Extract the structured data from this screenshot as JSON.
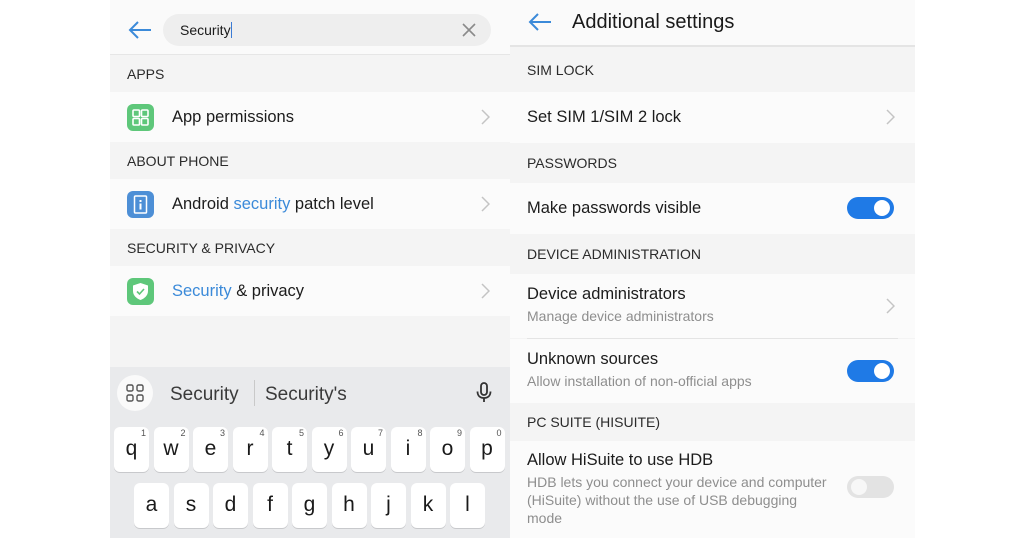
{
  "left_screen": {
    "search": {
      "value": "Security",
      "clear_icon": "close-icon",
      "back_icon": "arrow-left-icon"
    },
    "sections": [
      {
        "header": "APPS",
        "items": [
          {
            "icon": "app-permissions-icon",
            "icon_color": "#5ec77a",
            "label_parts": [
              {
                "text": "App permissions",
                "highlight": false
              }
            ]
          }
        ]
      },
      {
        "header": "ABOUT PHONE",
        "items": [
          {
            "icon": "phone-info-icon",
            "icon_color": "#4d8fd6",
            "label_parts": [
              {
                "text": "Android ",
                "highlight": false
              },
              {
                "text": "security",
                "highlight": true
              },
              {
                "text": " patch level",
                "highlight": false
              }
            ]
          }
        ]
      },
      {
        "header": "SECURITY & PRIVACY",
        "items": [
          {
            "icon": "shield-check-icon",
            "icon_color": "#5ec77a",
            "label_parts": [
              {
                "text": "Security",
                "highlight": true
              },
              {
                "text": " & privacy",
                "highlight": false
              }
            ]
          }
        ]
      }
    ],
    "keyboard": {
      "suggestions": [
        "Security",
        "Security's"
      ],
      "row1": [
        {
          "key": "q",
          "num": "1"
        },
        {
          "key": "w",
          "num": "2"
        },
        {
          "key": "e",
          "num": "3"
        },
        {
          "key": "r",
          "num": "4"
        },
        {
          "key": "t",
          "num": "5"
        },
        {
          "key": "y",
          "num": "6"
        },
        {
          "key": "u",
          "num": "7"
        },
        {
          "key": "i",
          "num": "8"
        },
        {
          "key": "o",
          "num": "9"
        },
        {
          "key": "p",
          "num": "0"
        }
      ],
      "row2": [
        "a",
        "s",
        "d",
        "f",
        "g",
        "h",
        "j",
        "k",
        "l"
      ]
    }
  },
  "right_screen": {
    "title": "Additional settings",
    "sections": [
      {
        "header": "SIM LOCK",
        "items": [
          {
            "title": "Set SIM 1/SIM 2 lock",
            "control": "chevron"
          }
        ]
      },
      {
        "header": "PASSWORDS",
        "items": [
          {
            "title": "Make passwords visible",
            "control": "toggle",
            "on": true
          }
        ]
      },
      {
        "header": "DEVICE ADMINISTRATION",
        "items": [
          {
            "title": "Device administrators",
            "subtitle": "Manage device administrators",
            "control": "chevron"
          },
          {
            "title": "Unknown sources",
            "subtitle": "Allow installation of non-official apps",
            "control": "toggle",
            "on": true
          }
        ]
      },
      {
        "header": "PC SUITE (HISUITE)",
        "items": [
          {
            "title": "Allow HiSuite to use HDB",
            "subtitle": "HDB lets you connect your device and computer (HiSuite) without the use of USB debugging mode",
            "control": "toggle",
            "on": false
          }
        ]
      }
    ]
  },
  "colors": {
    "accent": "#1f7ae6",
    "highlight_text": "#3b8ad9",
    "back_arrow": "#3b8ad9"
  }
}
